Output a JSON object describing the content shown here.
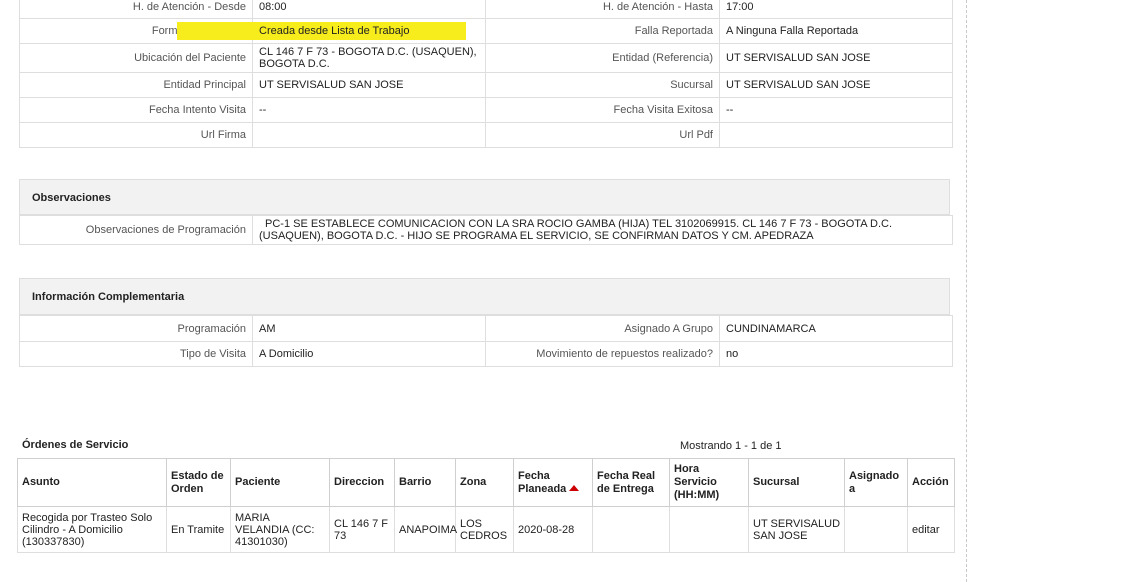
{
  "detail_rows": [
    {
      "l1": "H. de Atención - Desde",
      "v1": "08:00",
      "l2": "H. de Atención - Hasta",
      "v2": "17:00"
    },
    {
      "l1": "Forma de Creación",
      "v1": "Creada desde Lista de Trabajo",
      "l2": "Falla Reportada",
      "v2": "A Ninguna Falla Reportada"
    },
    {
      "l1": "Ubicación del Paciente",
      "v1": "CL 146 7 F 73 - BOGOTA D.C. (USAQUEN), BOGOTA D.C.",
      "l2": "Entidad (Referencia)",
      "v2": "UT SERVISALUD SAN JOSE"
    },
    {
      "l1": "Entidad Principal",
      "v1": "UT SERVISALUD SAN JOSE",
      "l2": "Sucursal",
      "v2": "UT SERVISALUD SAN JOSE"
    },
    {
      "l1": "Fecha Intento Visita",
      "v1": "--",
      "l2": "Fecha Visita Exitosa",
      "v2": "--"
    },
    {
      "l1": "Url Firma",
      "v1": "",
      "l2": "Url Pdf",
      "v2": ""
    }
  ],
  "highlight_color": "#f7ec1c",
  "observaciones": {
    "title": "Observaciones",
    "label": "Observaciones de Programación",
    "value": "PC-1 SE ESTABLECE COMUNICACION CON LA SRA ROCIO GAMBA (HIJA) TEL 3102069915. CL 146 7 F 73 - BOGOTA D.C. (USAQUEN), BOGOTA D.C. - HIJO SE PROGRAMA EL SERVICIO, SE CONFIRMAN DATOS Y CM. APEDRAZA"
  },
  "info": {
    "title": "Información Complementaria",
    "rows": [
      {
        "l1": "Programación",
        "v1": "AM",
        "l2": "Asignado A Grupo",
        "v2": "CUNDINAMARCA"
      },
      {
        "l1": "Tipo de Visita",
        "v1": "A Domicilio",
        "l2": "Movimiento de repuestos realizado?",
        "v2": "no"
      }
    ]
  },
  "ordenes": {
    "title": "Órdenes de Servicio",
    "count": "Mostrando 1 - 1 de 1",
    "headers": [
      "Asunto",
      "Estado de Orden",
      "Paciente",
      "Direccion",
      "Barrio",
      "Zona",
      "Fecha Planeada",
      "Fecha Real de Entrega",
      "Hora Servicio (HH:MM)",
      "Sucursal",
      "Asignado a",
      "Acción"
    ],
    "row": {
      "asunto": "Recogida por Trasteo Solo Cilindro - A Domicilio (130337830)",
      "estado": "En Tramite",
      "paciente": "MARIA VELANDIA (CC: 41301030)",
      "direccion": "CL 146 7 F 73",
      "barrio": "ANAPOIMA",
      "zona": "LOS CEDROS",
      "fecha_planeada": "2020-08-28",
      "fecha_real": "",
      "hora": "",
      "sucursal": "UT SERVISALUD SAN JOSE",
      "asignado": "",
      "accion": "editar"
    }
  }
}
